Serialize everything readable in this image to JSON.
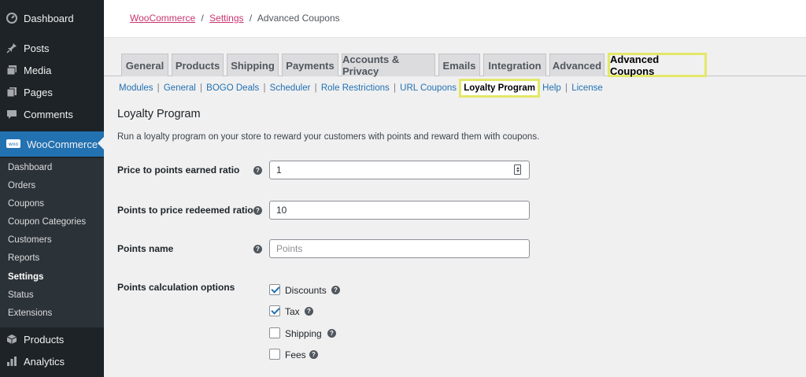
{
  "sidebar": {
    "top_items": [
      {
        "label": "Dashboard",
        "icon": "dashboard-icon"
      },
      {
        "label": "Posts",
        "icon": "pin-icon"
      },
      {
        "label": "Media",
        "icon": "media-icon"
      },
      {
        "label": "Pages",
        "icon": "pages-icon"
      },
      {
        "label": "Comments",
        "icon": "comments-icon"
      }
    ],
    "woocommerce": {
      "label": "WooCommerce",
      "icon": "woo-icon"
    },
    "submenu": [
      {
        "label": "Dashboard"
      },
      {
        "label": "Orders"
      },
      {
        "label": "Coupons"
      },
      {
        "label": "Coupon Categories"
      },
      {
        "label": "Customers"
      },
      {
        "label": "Reports"
      },
      {
        "label": "Settings",
        "current": true
      },
      {
        "label": "Status"
      },
      {
        "label": "Extensions"
      }
    ],
    "bottom_items": [
      {
        "label": "Products",
        "icon": "products-icon"
      },
      {
        "label": "Analytics",
        "icon": "analytics-icon"
      }
    ]
  },
  "breadcrumb": {
    "item1": "WooCommerce",
    "sep1": "/",
    "item2": "Settings",
    "sep2": "/",
    "current": "Advanced Coupons"
  },
  "tabs": [
    {
      "label": "General"
    },
    {
      "label": "Products"
    },
    {
      "label": "Shipping"
    },
    {
      "label": "Payments"
    },
    {
      "label": "Accounts & Privacy"
    },
    {
      "label": "Emails"
    },
    {
      "label": "Integration"
    },
    {
      "label": "Advanced"
    },
    {
      "label": "Advanced Coupons",
      "active": true
    }
  ],
  "subnav": [
    {
      "label": "Modules"
    },
    {
      "label": "General"
    },
    {
      "label": "BOGO Deals"
    },
    {
      "label": "Scheduler"
    },
    {
      "label": "Role Restrictions"
    },
    {
      "label": "URL Coupons"
    },
    {
      "label": "Loyalty Program",
      "current": true
    },
    {
      "label": "Help"
    },
    {
      "label": "License"
    }
  ],
  "section": {
    "title": "Loyalty Program",
    "description": "Run a loyalty program on your store to reward your customers with points and reward them with coupons."
  },
  "fields": {
    "price_to_points": {
      "label": "Price to points earned ratio",
      "value": "1"
    },
    "points_to_price": {
      "label": "Points to price redeemed ratio",
      "value": "10"
    },
    "points_name": {
      "label": "Points name",
      "value": "",
      "placeholder": "Points"
    },
    "calc_options": {
      "label": "Points calculation options",
      "options": [
        {
          "label": "Discounts",
          "checked": true
        },
        {
          "label": "Tax",
          "checked": true
        },
        {
          "label": "Shipping",
          "checked": false
        },
        {
          "label": "Fees",
          "checked": false
        }
      ]
    }
  },
  "help_glyph": "?",
  "colors": {
    "sidebar_bg": "#1d2327",
    "submenu_bg": "#2c3338",
    "active_menu": "#2271b1",
    "highlight": "#e3e868",
    "link": "#2271b1",
    "breadcrumb_link": "#c9356e"
  }
}
